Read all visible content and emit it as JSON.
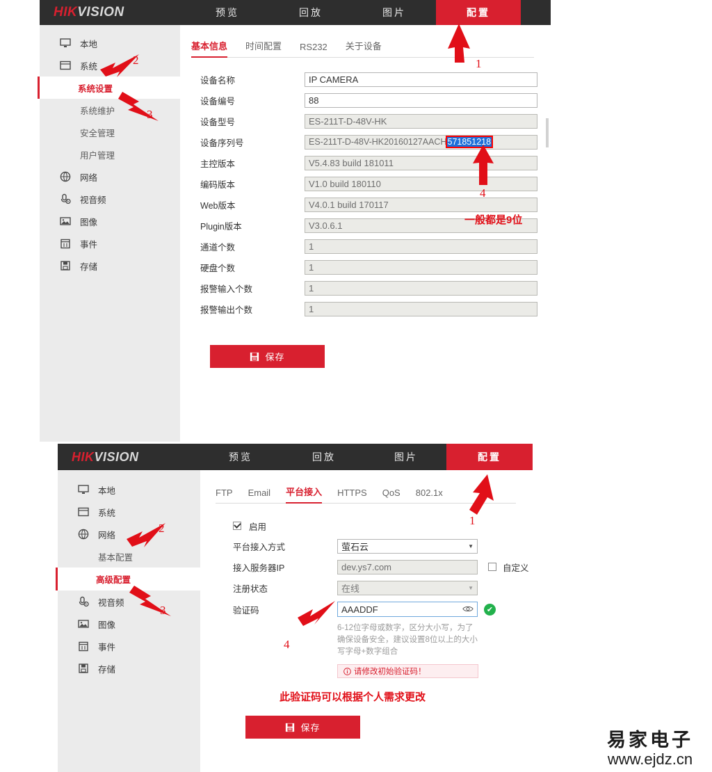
{
  "brand": {
    "hik": "HIK",
    "vision": "VISION"
  },
  "nav": [
    {
      "label": "预览",
      "active": false
    },
    {
      "label": "回放",
      "active": false
    },
    {
      "label": "图片",
      "active": false
    },
    {
      "label": "配置",
      "active": true
    }
  ],
  "panel1": {
    "sidebar": [
      {
        "label": "本地",
        "icon": "monitor-icon",
        "type": "top"
      },
      {
        "label": "系统",
        "icon": "window-icon",
        "type": "top"
      },
      {
        "label": "系统设置",
        "icon": "",
        "type": "sub",
        "active": true
      },
      {
        "label": "系统维护",
        "icon": "",
        "type": "sub",
        "active": false
      },
      {
        "label": "安全管理",
        "icon": "",
        "type": "sub",
        "active": false
      },
      {
        "label": "用户管理",
        "icon": "",
        "type": "sub",
        "active": false
      },
      {
        "label": "网络",
        "icon": "globe-icon",
        "type": "top"
      },
      {
        "label": "视音频",
        "icon": "mic-icon",
        "type": "top"
      },
      {
        "label": "图像",
        "icon": "picture-icon",
        "type": "top"
      },
      {
        "label": "事件",
        "icon": "calendar-icon",
        "type": "top"
      },
      {
        "label": "存储",
        "icon": "save-icon",
        "type": "top"
      }
    ],
    "tabs": [
      {
        "label": "基本信息",
        "active": true
      },
      {
        "label": "时间配置",
        "active": false
      },
      {
        "label": "RS232",
        "active": false
      },
      {
        "label": "关于设备",
        "active": false
      }
    ],
    "fields": [
      {
        "label": "设备名称",
        "value": "IP CAMERA",
        "readonly": false
      },
      {
        "label": "设备编号",
        "value": "88",
        "readonly": false
      },
      {
        "label": "设备型号",
        "value": "ES-211T-D-48V-HK",
        "readonly": true
      },
      {
        "label": "设备序列号",
        "value": "ES-211T-D-48V-HK20160127AACH",
        "highlight": "571851218",
        "readonly": true
      },
      {
        "label": "主控版本",
        "value": "V5.4.83 build 181011",
        "readonly": true
      },
      {
        "label": "编码版本",
        "value": "V1.0 build 180110",
        "readonly": true
      },
      {
        "label": "Web版本",
        "value": "V4.0.1 build 170117",
        "readonly": true
      },
      {
        "label": "Plugin版本",
        "value": "V3.0.6.1",
        "readonly": true
      },
      {
        "label": "通道个数",
        "value": "1",
        "readonly": true
      },
      {
        "label": "硬盘个数",
        "value": "1",
        "readonly": true
      },
      {
        "label": "报警输入个数",
        "value": "1",
        "readonly": true
      },
      {
        "label": "报警输出个数",
        "value": "1",
        "readonly": true
      }
    ],
    "save_label": "保存",
    "annotations": {
      "n1": "1",
      "n2": "2",
      "n3": "3",
      "n4": "4",
      "note_digits": "一般都是9位"
    }
  },
  "panel2": {
    "sidebar": [
      {
        "label": "本地",
        "icon": "monitor-icon",
        "type": "top"
      },
      {
        "label": "系统",
        "icon": "window-icon",
        "type": "top"
      },
      {
        "label": "网络",
        "icon": "globe-icon",
        "type": "top"
      },
      {
        "label": "基本配置",
        "icon": "",
        "type": "sub",
        "active": false
      },
      {
        "label": "高级配置",
        "icon": "",
        "type": "sub",
        "active": true
      },
      {
        "label": "视音频",
        "icon": "mic-icon",
        "type": "top"
      },
      {
        "label": "图像",
        "icon": "picture-icon",
        "type": "top"
      },
      {
        "label": "事件",
        "icon": "calendar-icon",
        "type": "top"
      },
      {
        "label": "存储",
        "icon": "save-icon",
        "type": "top"
      }
    ],
    "tabs": [
      {
        "label": "FTP",
        "active": false
      },
      {
        "label": "Email",
        "active": false
      },
      {
        "label": "平台接入",
        "active": true
      },
      {
        "label": "HTTPS",
        "active": false
      },
      {
        "label": "QoS",
        "active": false
      },
      {
        "label": "802.1x",
        "active": false
      }
    ],
    "enable_label": "启用",
    "enable_checked": true,
    "rows": {
      "mode_label": "平台接入方式",
      "mode_value": "萤石云",
      "server_label": "接入服务器IP",
      "server_value": "dev.ys7.com",
      "custom_label": "自定义",
      "custom_checked": false,
      "status_label": "注册状态",
      "status_value": "在线",
      "code_label": "验证码",
      "code_value": "AAADDF"
    },
    "hint": "6-12位字母或数字，区分大小写，为了确保设备安全，建议设置8位以上的大小写字母+数字组合",
    "warning": "请修改初始验证码！",
    "red_note": "此验证码可以根据个人需求更改",
    "save_label": "保存",
    "annotations": {
      "n1": "1",
      "n2": "2",
      "n3": "3",
      "n4": "4"
    }
  },
  "watermark": {
    "cn": "易家电子",
    "url": "www.ejdz.cn"
  }
}
